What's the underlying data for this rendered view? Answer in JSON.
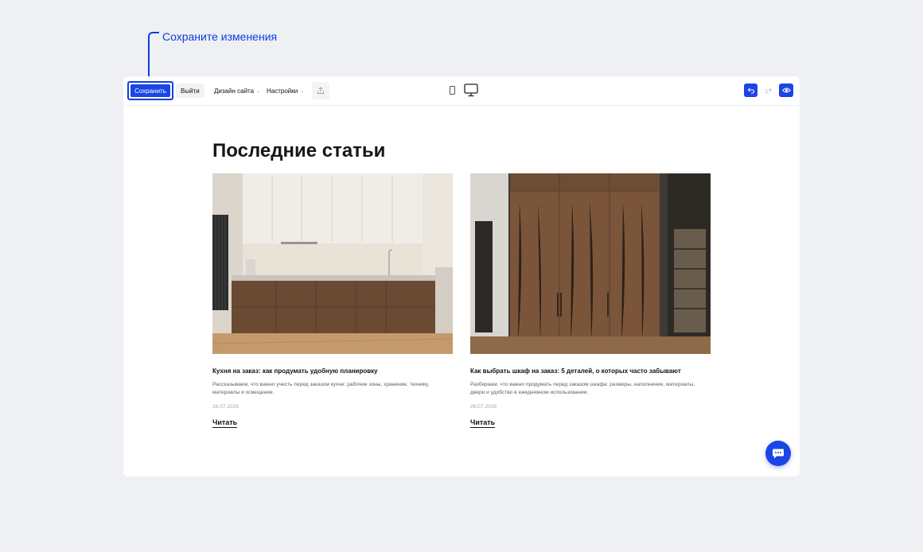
{
  "callout": {
    "text": "Сохраните изменения"
  },
  "toolbar": {
    "save_label": "Сохранить",
    "exit_label": "Выйти",
    "menus": [
      {
        "label": "Дизайн сайта",
        "caret": "⌄"
      },
      {
        "label": "Настройки",
        "caret": "⌄"
      }
    ],
    "icons": [
      "upload-icon",
      "mobile-view-icon",
      "desktop-view-icon",
      "undo-icon",
      "redo-icon",
      "eye-icon"
    ],
    "accent": "#1c45e6"
  },
  "main": {
    "heading": "Последние статьи",
    "articles": [
      {
        "title": "Кухня на заказ: как продумать удобную планировку",
        "description": "Рассказываем, что важно учесть перед заказом кухни: рабочие зоны, хранение, технику, материалы и освещение.",
        "date": "26.07.2026",
        "read_label": "Читать",
        "image": "kitchen-photo"
      },
      {
        "title": "Как выбрать шкаф на заказ: 5 деталей, о которых часто забывают",
        "description": "Разбираем, что важно продумать перед заказом шкафа: размеры, наполнение, материалы, двери и удобство в ежедневном использовании.",
        "date": "26.07.2026",
        "read_label": "Читать",
        "image": "wardrobe-photo"
      }
    ]
  },
  "chat": {
    "icon": "chat-icon"
  }
}
